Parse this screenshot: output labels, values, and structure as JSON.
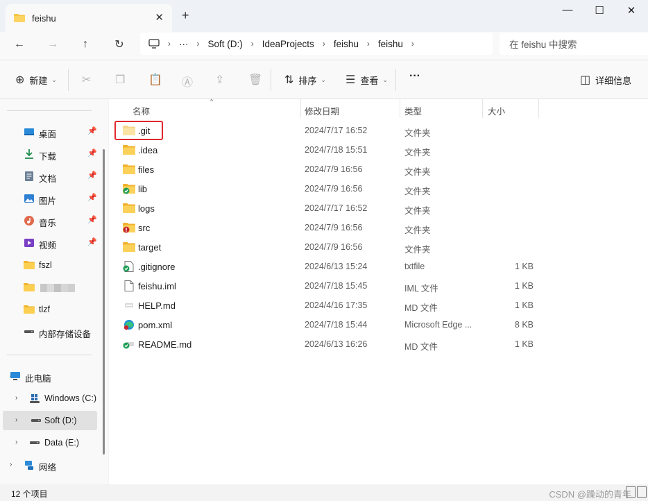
{
  "window": {
    "tab_title": "feishu",
    "tab_close": "✕",
    "new_tab": "+",
    "minimize": "—",
    "maximize": "☐",
    "close": "✕"
  },
  "nav": {
    "back": "←",
    "forward": "→",
    "up": "↑",
    "refresh": "↻",
    "more": "···",
    "breadcrumbs": [
      "Soft (D:)",
      "IdeaProjects",
      "feishu",
      "feishu"
    ],
    "search_placeholder": "在 feishu 中搜索"
  },
  "commands": {
    "new_label": "新建",
    "sort_label": "排序",
    "view_label": "查看",
    "more": "···",
    "details_label": "详细信息"
  },
  "sidebar": {
    "quick_access": [
      {
        "label": "桌面",
        "icon": "desktop-icon",
        "pinned": true
      },
      {
        "label": "下载",
        "icon": "download-icon",
        "pinned": true
      },
      {
        "label": "文档",
        "icon": "documents-icon",
        "pinned": true
      },
      {
        "label": "图片",
        "icon": "pictures-icon",
        "pinned": true
      },
      {
        "label": "音乐",
        "icon": "music-icon",
        "pinned": true
      },
      {
        "label": "视频",
        "icon": "videos-icon",
        "pinned": true
      },
      {
        "label": "fszl",
        "icon": "folder-icon",
        "pinned": false
      },
      {
        "label": "",
        "icon": "folder-icon",
        "pinned": false
      },
      {
        "label": "tlzf",
        "icon": "folder-icon",
        "pinned": false
      },
      {
        "label": "内部存储设备",
        "icon": "drive-icon",
        "pinned": false
      }
    ],
    "this_pc": "此电脑",
    "drives": [
      "Windows (C:)",
      "Soft (D:)",
      "Data (E:)"
    ],
    "network": "网络"
  },
  "columns": {
    "name": "名称",
    "date": "修改日期",
    "type": "类型",
    "size": "大小"
  },
  "files": [
    {
      "name": ".git",
      "date": "2024/7/17 16:52",
      "type": "文件夹",
      "size": "",
      "icon": "folder-hidden-icon"
    },
    {
      "name": ".idea",
      "date": "2024/7/18 15:51",
      "type": "文件夹",
      "size": "",
      "icon": "folder-icon"
    },
    {
      "name": "files",
      "date": "2024/7/9 16:56",
      "type": "文件夹",
      "size": "",
      "icon": "folder-icon"
    },
    {
      "name": "lib",
      "date": "2024/7/9 16:56",
      "type": "文件夹",
      "size": "",
      "icon": "folder-synced-icon"
    },
    {
      "name": "logs",
      "date": "2024/7/17 16:52",
      "type": "文件夹",
      "size": "",
      "icon": "folder-icon"
    },
    {
      "name": "src",
      "date": "2024/7/9 16:56",
      "type": "文件夹",
      "size": "",
      "icon": "folder-error-icon"
    },
    {
      "name": "target",
      "date": "2024/7/9 16:56",
      "type": "文件夹",
      "size": "",
      "icon": "folder-icon"
    },
    {
      "name": ".gitignore",
      "date": "2024/6/13 15:24",
      "type": "txtfile",
      "size": "1 KB",
      "icon": "file-synced-icon"
    },
    {
      "name": "feishu.iml",
      "date": "2024/7/18 15:45",
      "type": "IML 文件",
      "size": "1 KB",
      "icon": "file-icon"
    },
    {
      "name": "HELP.md",
      "date": "2024/4/16 17:35",
      "type": "MD 文件",
      "size": "1 KB",
      "icon": "md-file-icon"
    },
    {
      "name": "pom.xml",
      "date": "2024/7/18 15:44",
      "type": "Microsoft Edge ...",
      "size": "8 KB",
      "icon": "edge-file-icon"
    },
    {
      "name": "README.md",
      "date": "2024/6/13 16:26",
      "type": "MD 文件",
      "size": "1 KB",
      "icon": "md-synced-icon"
    }
  ],
  "status": {
    "item_count": "12 个项目",
    "watermark": "CSDN @躁动的青年"
  }
}
